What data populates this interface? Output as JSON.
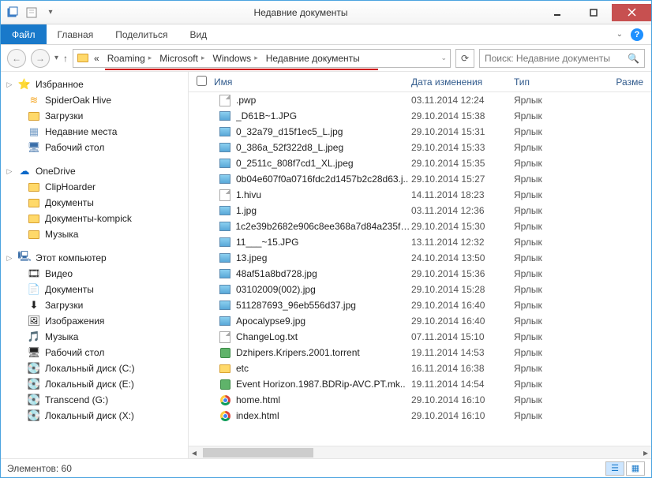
{
  "window": {
    "title": "Недавние документы"
  },
  "ribbon": {
    "file": "Файл",
    "tabs": [
      "Главная",
      "Поделиться",
      "Вид"
    ]
  },
  "breadcrumb": {
    "prefix": "«",
    "segs": [
      "Roaming",
      "Microsoft",
      "Windows",
      "Недавние документы"
    ]
  },
  "search": {
    "placeholder": "Поиск: Недавние документы"
  },
  "nav": {
    "favorites": {
      "label": "Избранное",
      "items": [
        "SpiderOak Hive",
        "Загрузки",
        "Недавние места",
        "Рабочий стол"
      ]
    },
    "onedrive": {
      "label": "OneDrive",
      "items": [
        "ClipHoarder",
        "Документы",
        "Документы-kompick",
        "Музыка"
      ]
    },
    "thispc": {
      "label": "Этот компьютер",
      "items": [
        "Видео",
        "Документы",
        "Загрузки",
        "Изображения",
        "Музыка",
        "Рабочий стол",
        "Локальный диск (C:)",
        "Локальный диск (E:)",
        "Transcend (G:)",
        "Локальный диск (X:)"
      ]
    }
  },
  "columns": {
    "name": "Имя",
    "date": "Дата изменения",
    "type": "Тип",
    "size": "Разме"
  },
  "filetype": "Ярлык",
  "files": [
    {
      "icon": "page",
      "name": ".pwp",
      "date": "03.11.2014 12:24"
    },
    {
      "icon": "img",
      "name": "_D61B~1.JPG",
      "date": "29.10.2014 15:38"
    },
    {
      "icon": "img",
      "name": "0_32a79_d15f1ec5_L.jpg",
      "date": "29.10.2014 15:31"
    },
    {
      "icon": "img",
      "name": "0_386a_52f322d8_L.jpeg",
      "date": "29.10.2014 15:33"
    },
    {
      "icon": "img",
      "name": "0_2511c_808f7cd1_XL.jpeg",
      "date": "29.10.2014 15:35"
    },
    {
      "icon": "img",
      "name": "0b04e607f0a0716fdc2d1457b2c28d63.j..",
      "date": "29.10.2014 15:27"
    },
    {
      "icon": "page",
      "name": "1.hivu",
      "date": "14.11.2014 18:23"
    },
    {
      "icon": "img",
      "name": "1.jpg",
      "date": "03.11.2014 12:36"
    },
    {
      "icon": "img",
      "name": "1c2e39b2682e906c8ee368a7d84a235f_f..",
      "date": "29.10.2014 15:30"
    },
    {
      "icon": "img",
      "name": "11___~15.JPG",
      "date": "13.11.2014 12:32"
    },
    {
      "icon": "img",
      "name": "13.jpeg",
      "date": "24.10.2014 13:50"
    },
    {
      "icon": "img",
      "name": "48af51a8bd728.jpg",
      "date": "29.10.2014 15:36"
    },
    {
      "icon": "img",
      "name": "03102009(002).jpg",
      "date": "29.10.2014 15:28"
    },
    {
      "icon": "img",
      "name": "511287693_96eb556d37.jpg",
      "date": "29.10.2014 16:40"
    },
    {
      "icon": "img",
      "name": "Apocalypse9.jpg",
      "date": "29.10.2014 16:40"
    },
    {
      "icon": "page",
      "name": "ChangeLog.txt",
      "date": "07.11.2014 15:10"
    },
    {
      "icon": "torrent",
      "name": "Dzhipers.Kripers.2001.torrent",
      "date": "19.11.2014 14:53"
    },
    {
      "icon": "folder",
      "name": "etc",
      "date": "16.11.2014 16:38"
    },
    {
      "icon": "torrent",
      "name": "Event Horizon.1987.BDRip-AVC.PT.mk..",
      "date": "19.11.2014 14:54"
    },
    {
      "icon": "chrome",
      "name": "home.html",
      "date": "29.10.2014 16:10"
    },
    {
      "icon": "chrome",
      "name": "index.html",
      "date": "29.10.2014 16:10"
    }
  ],
  "status": {
    "count_label": "Элементов:",
    "count": "60"
  }
}
